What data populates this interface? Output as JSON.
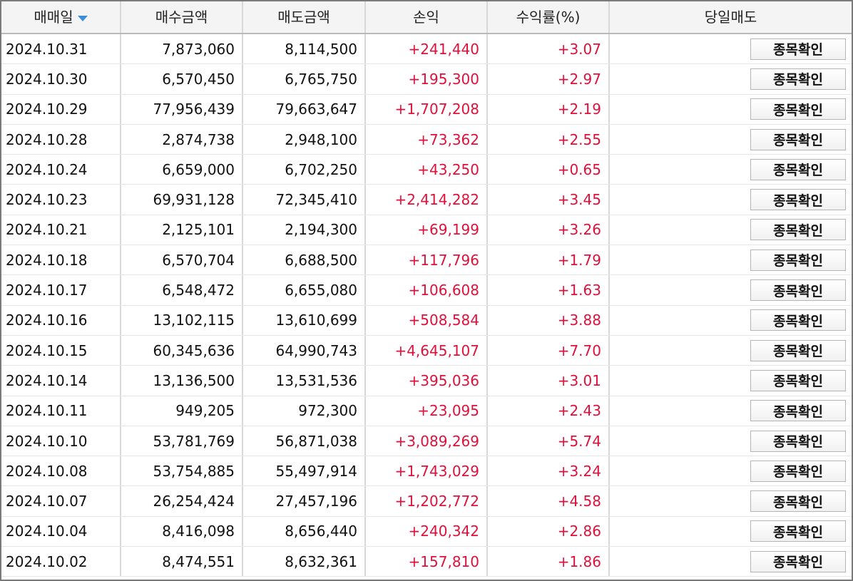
{
  "header": {
    "date": "매매일",
    "buy_amount": "매수금액",
    "sell_amount": "매도금액",
    "profit": "손익",
    "return_rate": "수익률(%)",
    "day_sell": "당일매도"
  },
  "colors": {
    "profit": "#e0103a",
    "sort_arrow": "#3a8fd6"
  },
  "button_label": "종목확인",
  "rows": [
    {
      "date": "2024.10.31",
      "buy": "7,873,060",
      "sell": "8,114,500",
      "profit": "+241,440",
      "rate": "+3.07"
    },
    {
      "date": "2024.10.30",
      "buy": "6,570,450",
      "sell": "6,765,750",
      "profit": "+195,300",
      "rate": "+2.97"
    },
    {
      "date": "2024.10.29",
      "buy": "77,956,439",
      "sell": "79,663,647",
      "profit": "+1,707,208",
      "rate": "+2.19"
    },
    {
      "date": "2024.10.28",
      "buy": "2,874,738",
      "sell": "2,948,100",
      "profit": "+73,362",
      "rate": "+2.55"
    },
    {
      "date": "2024.10.24",
      "buy": "6,659,000",
      "sell": "6,702,250",
      "profit": "+43,250",
      "rate": "+0.65"
    },
    {
      "date": "2024.10.23",
      "buy": "69,931,128",
      "sell": "72,345,410",
      "profit": "+2,414,282",
      "rate": "+3.45"
    },
    {
      "date": "2024.10.21",
      "buy": "2,125,101",
      "sell": "2,194,300",
      "profit": "+69,199",
      "rate": "+3.26"
    },
    {
      "date": "2024.10.18",
      "buy": "6,570,704",
      "sell": "6,688,500",
      "profit": "+117,796",
      "rate": "+1.79"
    },
    {
      "date": "2024.10.17",
      "buy": "6,548,472",
      "sell": "6,655,080",
      "profit": "+106,608",
      "rate": "+1.63"
    },
    {
      "date": "2024.10.16",
      "buy": "13,102,115",
      "sell": "13,610,699",
      "profit": "+508,584",
      "rate": "+3.88"
    },
    {
      "date": "2024.10.15",
      "buy": "60,345,636",
      "sell": "64,990,743",
      "profit": "+4,645,107",
      "rate": "+7.70"
    },
    {
      "date": "2024.10.14",
      "buy": "13,136,500",
      "sell": "13,531,536",
      "profit": "+395,036",
      "rate": "+3.01"
    },
    {
      "date": "2024.10.11",
      "buy": "949,205",
      "sell": "972,300",
      "profit": "+23,095",
      "rate": "+2.43"
    },
    {
      "date": "2024.10.10",
      "buy": "53,781,769",
      "sell": "56,871,038",
      "profit": "+3,089,269",
      "rate": "+5.74"
    },
    {
      "date": "2024.10.08",
      "buy": "53,754,885",
      "sell": "55,497,914",
      "profit": "+1,743,029",
      "rate": "+3.24"
    },
    {
      "date": "2024.10.07",
      "buy": "26,254,424",
      "sell": "27,457,196",
      "profit": "+1,202,772",
      "rate": "+4.58"
    },
    {
      "date": "2024.10.04",
      "buy": "8,416,098",
      "sell": "8,656,440",
      "profit": "+240,342",
      "rate": "+2.86"
    },
    {
      "date": "2024.10.02",
      "buy": "8,474,551",
      "sell": "8,632,361",
      "profit": "+157,810",
      "rate": "+1.86"
    }
  ]
}
